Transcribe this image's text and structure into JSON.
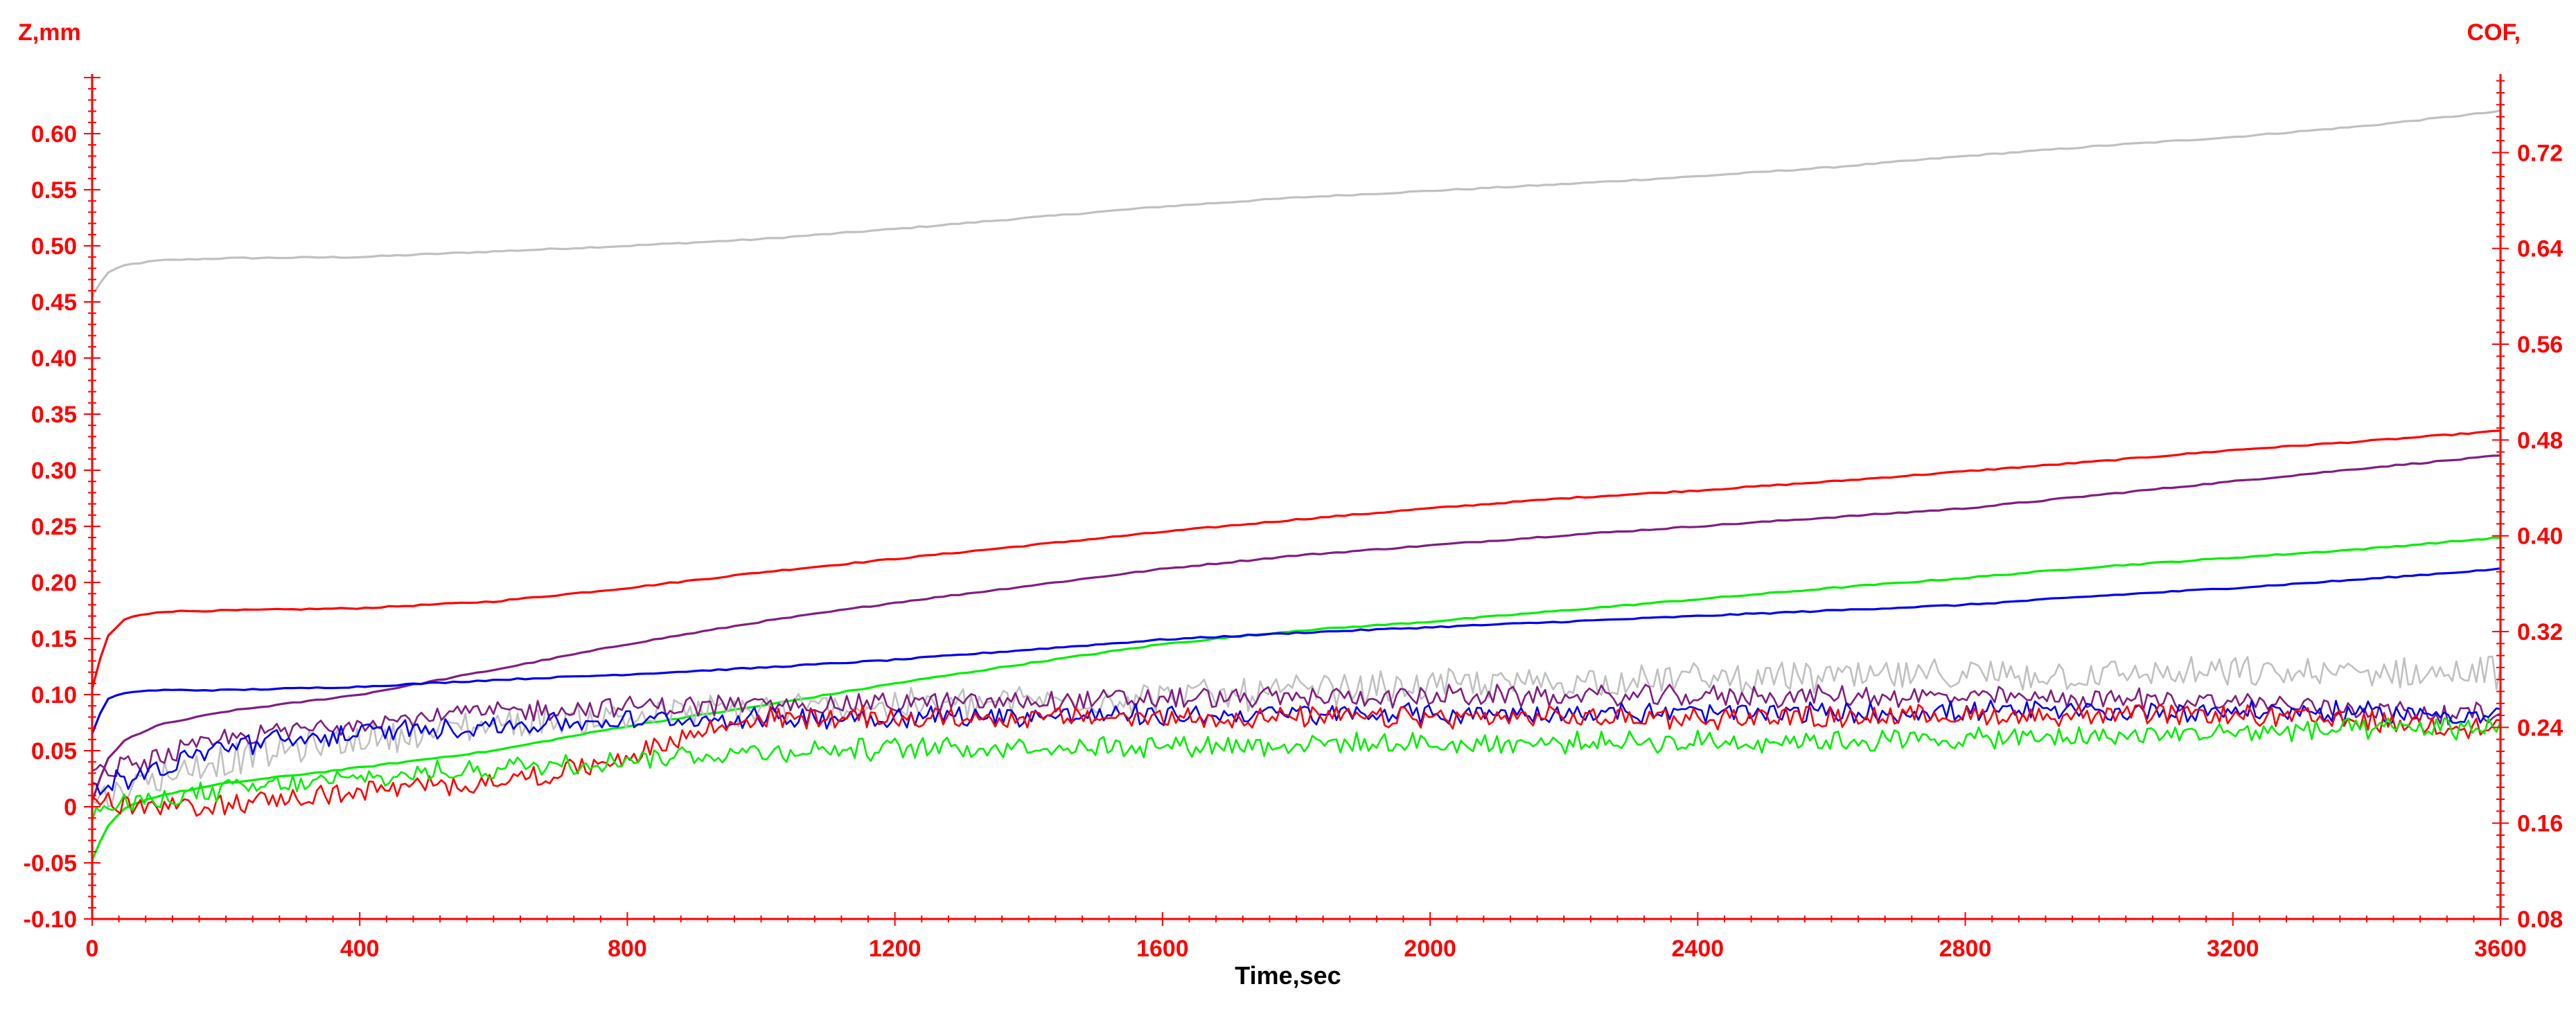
{
  "chart_data": {
    "type": "line",
    "xlabel": "Time,sec",
    "ylabel_left": "Z,mm",
    "ylabel_right": "COF,",
    "xlim": [
      0,
      3600
    ],
    "ylim_left": [
      -0.1,
      0.65
    ],
    "ylim_right": [
      0.08,
      0.7827
    ],
    "x_ticks": [
      "0",
      "400",
      "800",
      "1200",
      "1600",
      "2000",
      "2400",
      "2800",
      "3200",
      "3600"
    ],
    "y_left_ticks": [
      "-0.10",
      "-0.05",
      "0",
      "0.05",
      "0.10",
      "0.15",
      "0.20",
      "0.25",
      "0.30",
      "0.35",
      "0.40",
      "0.45",
      "0.50",
      "0.55",
      "0.60"
    ],
    "y_right_ticks": [
      "0.08",
      "0.16",
      "0.24",
      "0.32",
      "0.40",
      "0.48",
      "0.56",
      "0.64",
      "0.72"
    ],
    "axis_color": "#ff0000",
    "grid": false,
    "legend": "none",
    "series": [
      {
        "color": "#c0c0c0",
        "axis": "left",
        "noisy": false,
        "x": [
          0,
          20,
          50,
          100,
          200,
          400,
          600,
          800,
          1000,
          1200,
          1400,
          1600,
          1800,
          2000,
          2200,
          2400,
          2600,
          2800,
          3000,
          3200,
          3400,
          3600
        ],
        "y": [
          0.455,
          0.475,
          0.483,
          0.487,
          0.489,
          0.49,
          0.495,
          0.5,
          0.506,
          0.515,
          0.525,
          0.535,
          0.543,
          0.549,
          0.555,
          0.562,
          0.57,
          0.58,
          0.589,
          0.597,
          0.607,
          0.62
        ]
      },
      {
        "color": "#ff0000",
        "axis": "left",
        "noisy": false,
        "x": [
          0,
          20,
          50,
          100,
          200,
          400,
          600,
          800,
          1000,
          1200,
          1400,
          1600,
          1800,
          2000,
          2200,
          2400,
          2600,
          2800,
          3000,
          3200,
          3400,
          3600
        ],
        "y": [
          0.105,
          0.15,
          0.168,
          0.174,
          0.175,
          0.177,
          0.183,
          0.195,
          0.209,
          0.221,
          0.233,
          0.245,
          0.256,
          0.266,
          0.275,
          0.282,
          0.29,
          0.299,
          0.308,
          0.318,
          0.326,
          0.335
        ]
      },
      {
        "color": "#7f1f7f",
        "axis": "left",
        "noisy": false,
        "x": [
          0,
          20,
          50,
          100,
          200,
          400,
          600,
          800,
          1000,
          1200,
          1400,
          1600,
          1800,
          2000,
          2200,
          2400,
          2600,
          2800,
          3000,
          3200,
          3400,
          3600
        ],
        "y": [
          0.005,
          0.04,
          0.06,
          0.073,
          0.085,
          0.1,
          0.122,
          0.145,
          0.165,
          0.182,
          0.197,
          0.212,
          0.224,
          0.233,
          0.242,
          0.25,
          0.258,
          0.266,
          0.278,
          0.29,
          0.302,
          0.313
        ]
      },
      {
        "color": "#00ee00",
        "axis": "left",
        "noisy": false,
        "x": [
          0,
          20,
          50,
          100,
          200,
          400,
          600,
          800,
          1000,
          1200,
          1400,
          1600,
          1800,
          2000,
          2200,
          2400,
          2600,
          2800,
          3000,
          3200,
          3400,
          3600
        ],
        "y": [
          -0.048,
          -0.02,
          0.0,
          0.01,
          0.021,
          0.035,
          0.05,
          0.072,
          0.09,
          0.11,
          0.128,
          0.145,
          0.157,
          0.165,
          0.175,
          0.185,
          0.195,
          0.204,
          0.214,
          0.222,
          0.23,
          0.24
        ]
      },
      {
        "color": "#0000ee",
        "axis": "left",
        "noisy": false,
        "x": [
          0,
          20,
          50,
          100,
          200,
          400,
          600,
          800,
          1000,
          1200,
          1400,
          1600,
          1800,
          2000,
          2200,
          2400,
          2600,
          2800,
          3000,
          3200,
          3400,
          3600
        ],
        "y": [
          0.065,
          0.095,
          0.102,
          0.104,
          0.104,
          0.107,
          0.113,
          0.118,
          0.124,
          0.131,
          0.14,
          0.149,
          0.155,
          0.16,
          0.165,
          0.17,
          0.175,
          0.18,
          0.188,
          0.195,
          0.203,
          0.212
        ]
      },
      {
        "color": "#c0c0c0",
        "axis": "right",
        "noisy": true,
        "x": [
          0,
          100,
          200,
          400,
          600,
          800,
          1000,
          1200,
          1400,
          1600,
          1800,
          2000,
          2200,
          2400,
          2600,
          2800,
          3000,
          3200,
          3400,
          3600
        ],
        "y": [
          0.18,
          0.2,
          0.213,
          0.23,
          0.243,
          0.25,
          0.255,
          0.258,
          0.262,
          0.266,
          0.27,
          0.275,
          0.278,
          0.281,
          0.282,
          0.283,
          0.284,
          0.285,
          0.285,
          0.286
        ]
      },
      {
        "color": "#7f1f7f",
        "axis": "right",
        "noisy": true,
        "x": [
          0,
          100,
          200,
          400,
          600,
          800,
          1000,
          1200,
          1400,
          1600,
          1800,
          2000,
          2200,
          2400,
          2600,
          2800,
          3000,
          3200,
          3400,
          3600
        ],
        "y": [
          0.2,
          0.215,
          0.23,
          0.245,
          0.253,
          0.257,
          0.259,
          0.26,
          0.262,
          0.264,
          0.265,
          0.266,
          0.266,
          0.266,
          0.266,
          0.265,
          0.264,
          0.262,
          0.255,
          0.25
        ]
      },
      {
        "color": "#0000ee",
        "axis": "right",
        "noisy": true,
        "x": [
          0,
          100,
          200,
          400,
          600,
          800,
          1000,
          1200,
          1400,
          1600,
          1800,
          2000,
          2200,
          2400,
          2600,
          2800,
          3000,
          3200,
          3400,
          3600
        ],
        "y": [
          0.19,
          0.205,
          0.225,
          0.235,
          0.242,
          0.245,
          0.248,
          0.249,
          0.25,
          0.25,
          0.251,
          0.251,
          0.252,
          0.252,
          0.252,
          0.253,
          0.253,
          0.254,
          0.252,
          0.25
        ]
      },
      {
        "color": "#ff0000",
        "axis": "right",
        "noisy": true,
        "x": [
          0,
          50,
          100,
          200,
          400,
          600,
          700,
          800,
          900,
          1000,
          1200,
          1400,
          1600,
          1800,
          2000,
          2200,
          2400,
          2600,
          2800,
          3000,
          3200,
          3400,
          3600
        ],
        "y": [
          0.18,
          0.175,
          0.172,
          0.176,
          0.186,
          0.195,
          0.202,
          0.215,
          0.235,
          0.248,
          0.248,
          0.248,
          0.248,
          0.248,
          0.248,
          0.248,
          0.248,
          0.249,
          0.25,
          0.25,
          0.25,
          0.245,
          0.24
        ]
      },
      {
        "color": "#00ee00",
        "axis": "right",
        "noisy": true,
        "x": [
          0,
          100,
          200,
          400,
          600,
          800,
          1000,
          1200,
          1400,
          1600,
          1800,
          2000,
          2200,
          2400,
          2600,
          2800,
          3000,
          3200,
          3400,
          3600
        ],
        "y": [
          0.17,
          0.18,
          0.188,
          0.197,
          0.206,
          0.214,
          0.22,
          0.222,
          0.224,
          0.225,
          0.226,
          0.226,
          0.227,
          0.228,
          0.229,
          0.23,
          0.232,
          0.236,
          0.238,
          0.24
        ]
      }
    ]
  }
}
